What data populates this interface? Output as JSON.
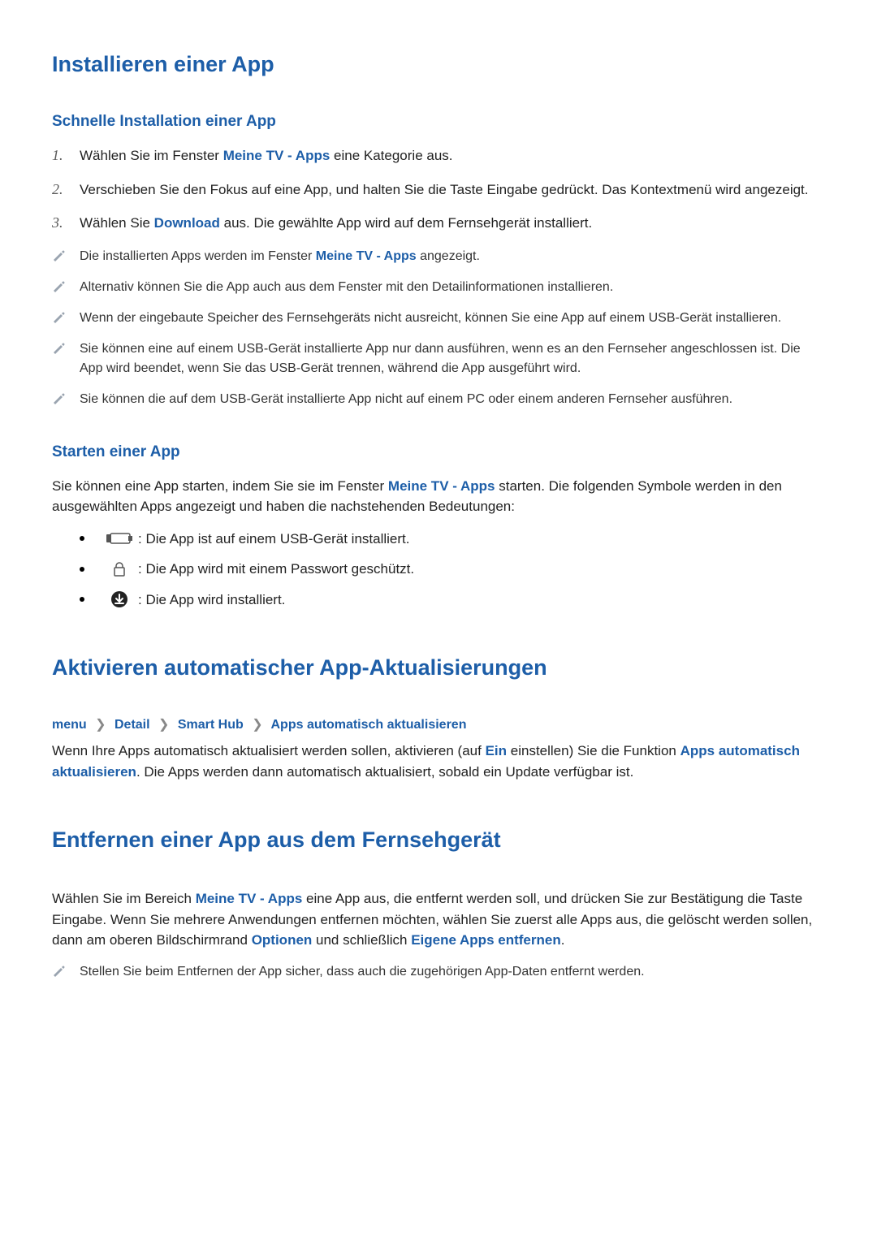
{
  "section1": {
    "title": "Installieren einer App",
    "sub1": {
      "title": "Schnelle Installation einer App",
      "steps": [
        {
          "num": "1.",
          "pre": "Wählen Sie im Fenster ",
          "b1": "Meine TV - Apps",
          "post": " eine Kategorie aus."
        },
        {
          "num": "2.",
          "text": "Verschieben Sie den Fokus auf eine App, und halten Sie die Taste Eingabe gedrückt. Das Kontextmenü wird angezeigt."
        },
        {
          "num": "3.",
          "pre": "Wählen Sie ",
          "b1": "Download",
          "post": " aus. Die gewählte App wird auf dem Fernsehgerät installiert."
        }
      ],
      "notes": [
        {
          "pre": "Die installierten Apps werden im Fenster ",
          "b1": "Meine TV - Apps",
          "post": " angezeigt."
        },
        {
          "text": "Alternativ können Sie die App auch aus dem Fenster mit den Detailinformationen installieren."
        },
        {
          "text": "Wenn der eingebaute Speicher des Fernsehgeräts nicht ausreicht, können Sie eine App auf einem USB-Gerät installieren."
        },
        {
          "text": "Sie können eine auf einem USB-Gerät installierte App nur dann ausführen, wenn es an den Fernseher angeschlossen ist. Die App wird beendet, wenn Sie das USB-Gerät trennen, während die App ausgeführt wird."
        },
        {
          "text": "Sie können die auf dem USB-Gerät installierte App nicht auf einem PC oder einem anderen Fernseher ausführen."
        }
      ]
    },
    "sub2": {
      "title": "Starten einer App",
      "para_pre": "Sie können eine App starten, indem Sie sie im Fenster ",
      "para_b1": "Meine TV - Apps",
      "para_post": " starten. Die folgenden Symbole werden in den ausgewählten Apps angezeigt und haben die nachstehenden Bedeutungen:",
      "items": [
        {
          "icon": "usb",
          "text": " : Die App ist auf einem USB-Gerät installiert."
        },
        {
          "icon": "lock",
          "text": " : Die App wird mit einem Passwort geschützt."
        },
        {
          "icon": "download",
          "text": " : Die App wird installiert."
        }
      ]
    }
  },
  "section2": {
    "title": "Aktivieren automatischer App-Aktualisierungen",
    "breadcrumb": [
      "menu",
      "Detail",
      "Smart Hub",
      "Apps automatisch aktualisieren"
    ],
    "para": {
      "t1": "Wenn Ihre Apps automatisch aktualisiert werden sollen, aktivieren (auf ",
      "b1": "Ein",
      "t2": " einstellen) Sie die Funktion ",
      "b2": "Apps automatisch aktualisieren",
      "t3": ". Die Apps werden dann automatisch aktualisiert, sobald ein Update verfügbar ist."
    }
  },
  "section3": {
    "title": "Entfernen einer App aus dem Fernsehgerät",
    "para": {
      "t1": "Wählen Sie im Bereich ",
      "b1": "Meine TV - Apps",
      "t2": " eine App aus, die entfernt werden soll, und drücken Sie zur Bestätigung die Taste Eingabe. Wenn Sie mehrere Anwendungen entfernen möchten, wählen Sie zuerst alle Apps aus, die gelöscht werden sollen, dann am oberen Bildschirmrand ",
      "b2": "Optionen",
      "t3": " und schließlich ",
      "b3": "Eigene Apps entfernen",
      "t4": "."
    },
    "note": "Stellen Sie beim Entfernen der App sicher, dass auch die zugehörigen App-Daten entfernt werden."
  }
}
